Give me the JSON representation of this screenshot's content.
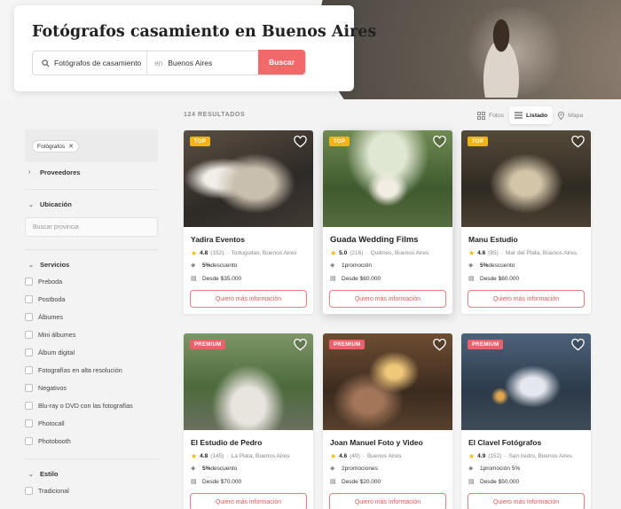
{
  "header": {
    "title": "Fotógrafos casamiento en Buenos Aires",
    "search_value": "Fotógrafos de casamiento",
    "in_label": "en",
    "location_value": "Buenos Aires",
    "search_button": "Buscar"
  },
  "toolbar": {
    "results": "124 RESULTADOS",
    "views": [
      "Fotos",
      "Listado",
      "Mapa"
    ],
    "active_view": "Listado"
  },
  "sidebar": {
    "active_filter": "Fotógrafos",
    "sections": {
      "proveedores": "Proveedores",
      "ubicacion": "Ubicación",
      "servicios": "Servicios",
      "estilo": "Estilo"
    },
    "province_placeholder": "Buscar provincia",
    "services": [
      "Preboda",
      "Postboda",
      "Álbumes",
      "Mini álbumes",
      "Álbum digital",
      "Fotografías en alta resolución",
      "Negativos",
      "Blu-ray o DVD con las fotografías",
      "Photocall",
      "Photobooth"
    ],
    "styles": [
      "Tradicional"
    ]
  },
  "cards": [
    {
      "badge": "TOP",
      "name": "Yadira Eventos",
      "score": "4.8",
      "reviews": "(152)",
      "location": "Tortuguitas, Buenos Aires",
      "promo_pct": "5%",
      "promo_text": " descuento",
      "price": "Desde $35.000",
      "cta": "Quiero más información"
    },
    {
      "badge": "TOP",
      "name": "Guada Wedding Films",
      "score": "5.0",
      "reviews": "(216)",
      "location": "Quilmes, Buenos Aires",
      "promo_pct": "1",
      "promo_text": " promoción",
      "price": "Desde $60.000",
      "cta": "Quiero más información"
    },
    {
      "badge": "TOP",
      "name": "Manu Estudio",
      "score": "4.6",
      "reviews": "(85)",
      "location": "Mar del Plata, Buenos Aires",
      "promo_pct": "5%",
      "promo_text": " descuento",
      "price": "Desde $60.000",
      "cta": "Quiero más información"
    },
    {
      "badge": "PREMIUM",
      "name": "El Estudio de Pedro",
      "score": "4.8",
      "reviews": "(145)",
      "location": "La Plata, Buenos Aires",
      "promo_pct": "5%",
      "promo_text": " descuento",
      "price": "Desde $70.000",
      "cta": "Quiero más información"
    },
    {
      "badge": "PREMIUM",
      "name": "Joan Manuel Foto y Video",
      "score": "4.6",
      "reviews": "(49)",
      "location": "Buenos Aires",
      "promo_pct": "2",
      "promo_text": " promociones",
      "price": "Desde $20.000",
      "cta": "Quiero más información"
    },
    {
      "badge": "PREMIUM",
      "name": "El Clavel Fotógrafos",
      "score": "4.9",
      "reviews": "(152)",
      "location": "San Isidro, Buenos Aires",
      "promo_pct": "1",
      "promo_text": " promoción 5%",
      "price": "Desde $50.000",
      "cta": "Quiero más información"
    }
  ],
  "colors": {
    "accent": "#f06a6a",
    "top_badge": "#f2b313",
    "premium_badge": "#e8616b",
    "star": "#f5b800"
  }
}
